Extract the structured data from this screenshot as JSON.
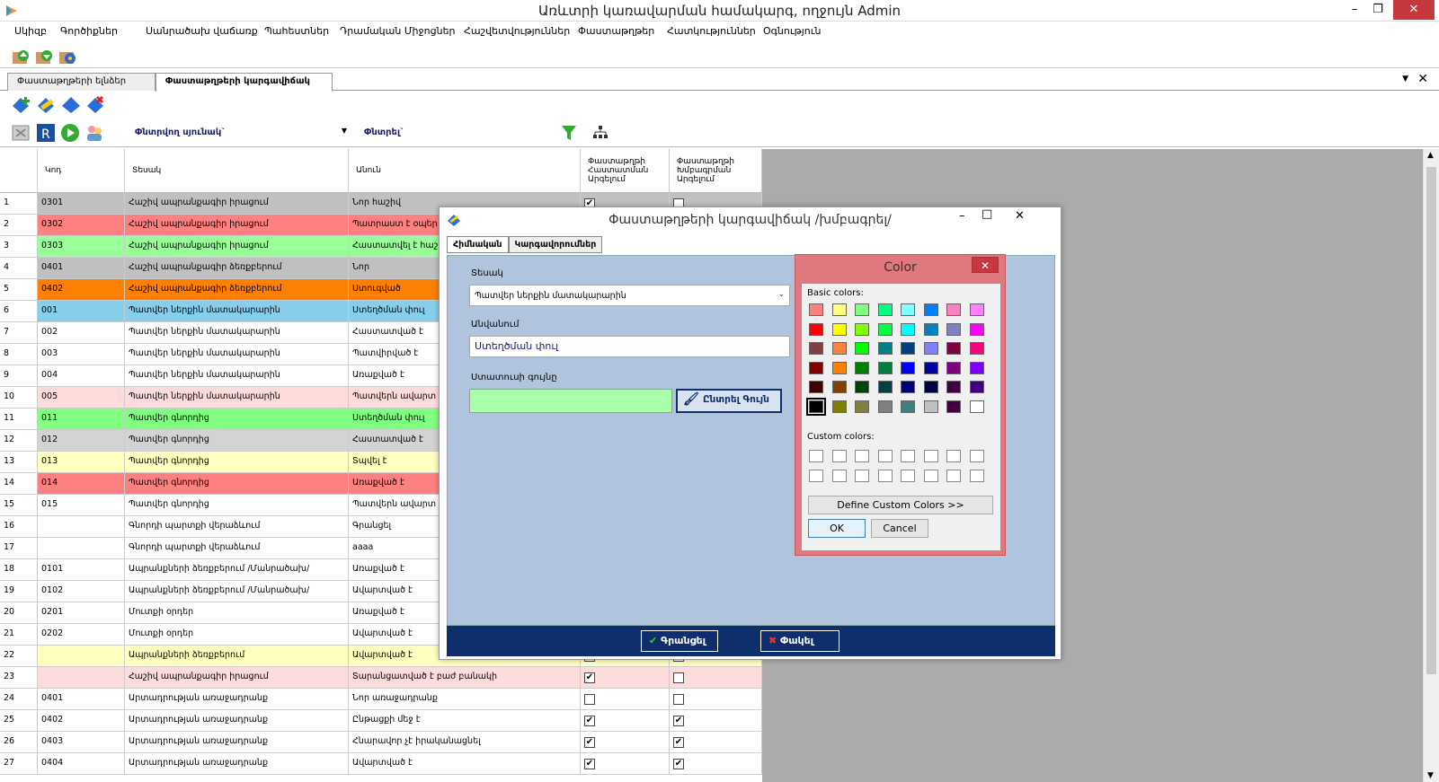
{
  "window": {
    "title": "Առևտրի կառավարման համակարգ, ողջույն Admin"
  },
  "menu": [
    "Սկիզբ",
    "Գործիքներ",
    "Սանրածախ վաճառք",
    "Պահեստներ",
    "Դրամական Միջոցներ",
    "Հաշվետվություններ",
    "Փաստաթղթեր",
    "Հատկություններ",
    "Օգնություն"
  ],
  "doc_tabs": [
    "Փաստաթղթերի ելնձեր",
    "Փաստաթղթերի կարգավիճակ"
  ],
  "filter": {
    "search_column_label": "Փնտրվող սյունակ`",
    "search_label": "Փնտրել`"
  },
  "columns": [
    "Կոդ",
    "Տեսակ",
    "Անուն",
    "Փաստաթղթի Հաստատման Արգելում",
    "Փաստաթղթի Խմբագրման Արգելում"
  ],
  "rows": [
    {
      "n": "1",
      "code": "0301",
      "type": "Հաշիվ ապրանքագիր իրացում",
      "name": "Նոր հաշիվ",
      "bg": "#c0c0c0",
      "c1": true,
      "c2": false
    },
    {
      "n": "2",
      "code": "0302",
      "type": "Հաշիվ ապրանքագիր իրացում",
      "name": "Պատրաստ է օպեր",
      "bg": "#ff8080",
      "c1": false,
      "c2": false
    },
    {
      "n": "3",
      "code": "0303",
      "type": "Հաշիվ ապրանքագիր իրացում",
      "name": "Հաստատվել է հաշի",
      "bg": "#99ff99",
      "c1": false,
      "c2": false
    },
    {
      "n": "4",
      "code": "0401",
      "type": "Հաշիվ ապրանքագիր ձեռքբերում",
      "name": "Նոր",
      "bg": "#c0c0c0",
      "c1": false,
      "c2": false
    },
    {
      "n": "5",
      "code": "0402",
      "type": "Հաշիվ ապրանքագիր ձեռքբերում",
      "name": "Ստուգված",
      "bg": "#ff8000",
      "c1": false,
      "c2": false
    },
    {
      "n": "6",
      "code": "001",
      "type": "Պատվեր ներքին մատակարարին",
      "name": "Ստեղծման փուլ",
      "bg": "#87ceeb",
      "c1": false,
      "c2": false
    },
    {
      "n": "7",
      "code": "002",
      "type": "Պատվեր ներքին մատակարարին",
      "name": "Հաստատված է",
      "bg": "#ffffff",
      "c1": false,
      "c2": false
    },
    {
      "n": "8",
      "code": "003",
      "type": "Պատվեր ներքին մատակարարին",
      "name": "Պատվիրված է",
      "bg": "#ffffff",
      "c1": false,
      "c2": false
    },
    {
      "n": "9",
      "code": "004",
      "type": "Պատվեր ներքին մատակարարին",
      "name": "Առաքված է",
      "bg": "#ffffff",
      "c1": false,
      "c2": false
    },
    {
      "n": "10",
      "code": "005",
      "type": "Պատվեր ներքին մատակարարին",
      "name": "Պատվերն ավարտ",
      "bg": "#ffdcdc",
      "c1": false,
      "c2": false
    },
    {
      "n": "11",
      "code": "011",
      "type": "Պատվեր գնորդից",
      "name": "Ստեղծման փուլ",
      "bg": "#80ff80",
      "c1": false,
      "c2": false
    },
    {
      "n": "12",
      "code": "012",
      "type": "Պատվեր գնորդից",
      "name": "Հաստատված է",
      "bg": "#d3d3d3",
      "c1": false,
      "c2": false
    },
    {
      "n": "13",
      "code": "013",
      "type": "Պատվեր գնորդից",
      "name": "Տպվել է",
      "bg": "#ffffc0",
      "c1": false,
      "c2": false
    },
    {
      "n": "14",
      "code": "014",
      "type": "Պատվեր գնորդից",
      "name": "Առաքված է",
      "bg": "#ff8080",
      "c1": false,
      "c2": false
    },
    {
      "n": "15",
      "code": "015",
      "type": "Պատվեր գնորդից",
      "name": "Պատվերն ավարտ",
      "bg": "#ffffff",
      "c1": false,
      "c2": false
    },
    {
      "n": "16",
      "code": "",
      "type": "Գնորդի պարտքի վերաձևում",
      "name": "Գրանցել",
      "bg": "#ffffff",
      "c1": false,
      "c2": false
    },
    {
      "n": "17",
      "code": "",
      "type": "Գնորդի պարտքի վերաձևում",
      "name": "aaaa",
      "bg": "#ffffff",
      "c1": false,
      "c2": false
    },
    {
      "n": "18",
      "code": "0101",
      "type": "Ապրանքների ձեռքբերում /Մանրածախ/",
      "name": "Առաքված է",
      "bg": "#ffffff",
      "c1": false,
      "c2": false
    },
    {
      "n": "19",
      "code": "0102",
      "type": "Ապրանքների ձեռքբերում /Մանրածախ/",
      "name": "Ավարտված է",
      "bg": "#ffffff",
      "c1": false,
      "c2": false
    },
    {
      "n": "20",
      "code": "0201",
      "type": "Մուտքի օրդեր",
      "name": "Առաքված է",
      "bg": "#ffffff",
      "c1": false,
      "c2": false
    },
    {
      "n": "21",
      "code": "0202",
      "type": "Մուտքի օրդեր",
      "name": "Ավարտված է",
      "bg": "#ffffff",
      "c1": false,
      "c2": false
    },
    {
      "n": "22",
      "code": "",
      "type": "Ապրանքների ձեռքբերում",
      "name": "Ավարտված է",
      "bg": "#ffffc0",
      "c1": false,
      "c2": false
    },
    {
      "n": "23",
      "code": "",
      "type": "Հաշիվ ապրանքագիր իրացում",
      "name": "Տարանցատված է բաժ բանակի",
      "bg": "#ffdcdc",
      "c1": true,
      "c2": false
    },
    {
      "n": "24",
      "code": "0401",
      "type": "Արտադրության առաջադրանք",
      "name": "Նոր առաջադրանք",
      "bg": "#ffffff",
      "c1": false,
      "c2": false
    },
    {
      "n": "25",
      "code": "0402",
      "type": "Արտադրության առաջադրանք",
      "name": "Ընթացքի մեջ է",
      "bg": "#ffffff",
      "c1": true,
      "c2": true
    },
    {
      "n": "26",
      "code": "0403",
      "type": "Արտադրության առաջադրանք",
      "name": "Հնարավոր չէ իրականացնել",
      "bg": "#ffffff",
      "c1": true,
      "c2": true
    },
    {
      "n": "27",
      "code": "0404",
      "type": "Արտադրության առաջադրանք",
      "name": "Ավարտված է",
      "bg": "#ffffff",
      "c1": true,
      "c2": true
    }
  ],
  "dialog": {
    "title": "Փաստաթղթերի կարգավիճակ /խմբագրել/",
    "tabs": [
      "Հիմնական",
      "Կարգավորումներ"
    ],
    "type_label": "Տեսակ",
    "type_value": "Պատվեր ներքին մատակարարին",
    "name_label": "Անվանում",
    "name_value": "Ստեղծման փուլ",
    "color_label": "Ստատուսի գույնը",
    "color_value": "#aaffaa",
    "choose_color": "Ընտրել Գույն",
    "save": "Գրանցել",
    "close": "Փակել"
  },
  "color_dialog": {
    "title": "Color",
    "basic_label": "Basic colors:",
    "custom_label": "Custom colors:",
    "define": "Define Custom Colors >>",
    "ok": "OK",
    "cancel": "Cancel",
    "basic": [
      "#ff8080",
      "#ffff80",
      "#80ff80",
      "#00ff80",
      "#80ffff",
      "#0080ff",
      "#ff80c0",
      "#ff80ff",
      "#ff0000",
      "#ffff00",
      "#80ff00",
      "#00ff40",
      "#00ffff",
      "#0080c0",
      "#8080c0",
      "#ff00ff",
      "#804040",
      "#ff8040",
      "#00ff00",
      "#008080",
      "#004080",
      "#8080ff",
      "#800040",
      "#ff0080",
      "#800000",
      "#ff8000",
      "#008000",
      "#008040",
      "#0000ff",
      "#0000a0",
      "#800080",
      "#8000ff",
      "#400000",
      "#804000",
      "#004000",
      "#004040",
      "#000080",
      "#000040",
      "#400040",
      "#400080",
      "#000000",
      "#808000",
      "#808040",
      "#808080",
      "#408080",
      "#c0c0c0",
      "#400040",
      "#ffffff"
    ]
  }
}
